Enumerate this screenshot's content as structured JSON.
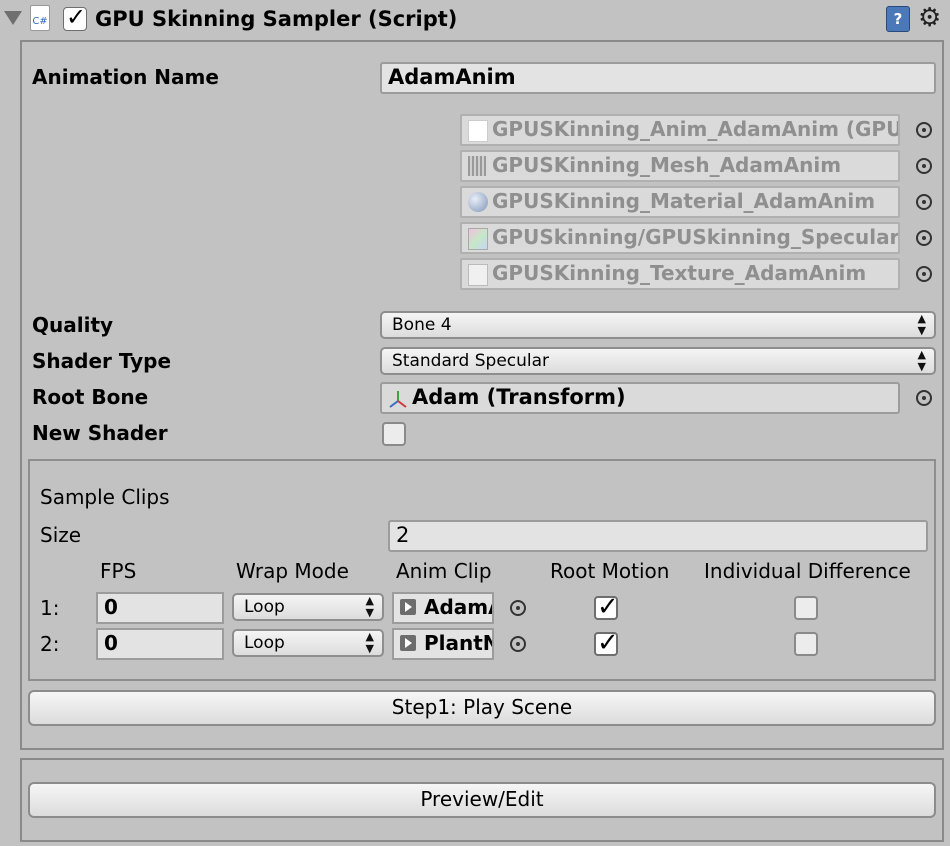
{
  "header": {
    "title": "GPU Skinning Sampler (Script)",
    "enabled": true,
    "script_icon_text": "C#",
    "icons": [
      "foldout-arrow",
      "csharp-script-icon",
      "help-icon",
      "gear-icon"
    ]
  },
  "animation_name": {
    "label": "Animation Name",
    "value": "AdamAnim"
  },
  "generated_assets": [
    {
      "name": "GPUSKinning_Anim_AdamAnim (GPU",
      "icon": "file-icon"
    },
    {
      "name": "GPUSKinning_Mesh_AdamAnim",
      "icon": "mesh-icon"
    },
    {
      "name": "GPUSKinning_Material_AdamAnim",
      "icon": "material-sphere-icon"
    },
    {
      "name": "GPUSkinning/GPUSkinning_Specular",
      "icon": "shader-icon"
    },
    {
      "name": "GPUSKinning_Texture_AdamAnim",
      "icon": "texture-icon"
    }
  ],
  "quality": {
    "label": "Quality",
    "value": "Bone 4"
  },
  "shader_type": {
    "label": "Shader Type",
    "value": "Standard Specular"
  },
  "root_bone": {
    "label": "Root Bone",
    "value": "Adam (Transform)"
  },
  "new_shader": {
    "label": "New Shader",
    "checked": false
  },
  "sample_clips": {
    "title": "Sample Clips",
    "size_label": "Size",
    "size": "2",
    "columns": [
      "FPS",
      "Wrap Mode",
      "Anim Clip",
      "Root Motion",
      "Individual Difference"
    ],
    "rows": [
      {
        "index": "1:",
        "fps": "0",
        "wrap_mode": "Loop",
        "clip": "AdamAnim",
        "root_motion": true,
        "individual_difference": false
      },
      {
        "index": "2:",
        "fps": "0",
        "wrap_mode": "Loop",
        "clip": "PlantNoise",
        "root_motion": true,
        "individual_difference": false
      }
    ]
  },
  "step1_button": "Step1: Play Scene",
  "preview_button": "Preview/Edit"
}
